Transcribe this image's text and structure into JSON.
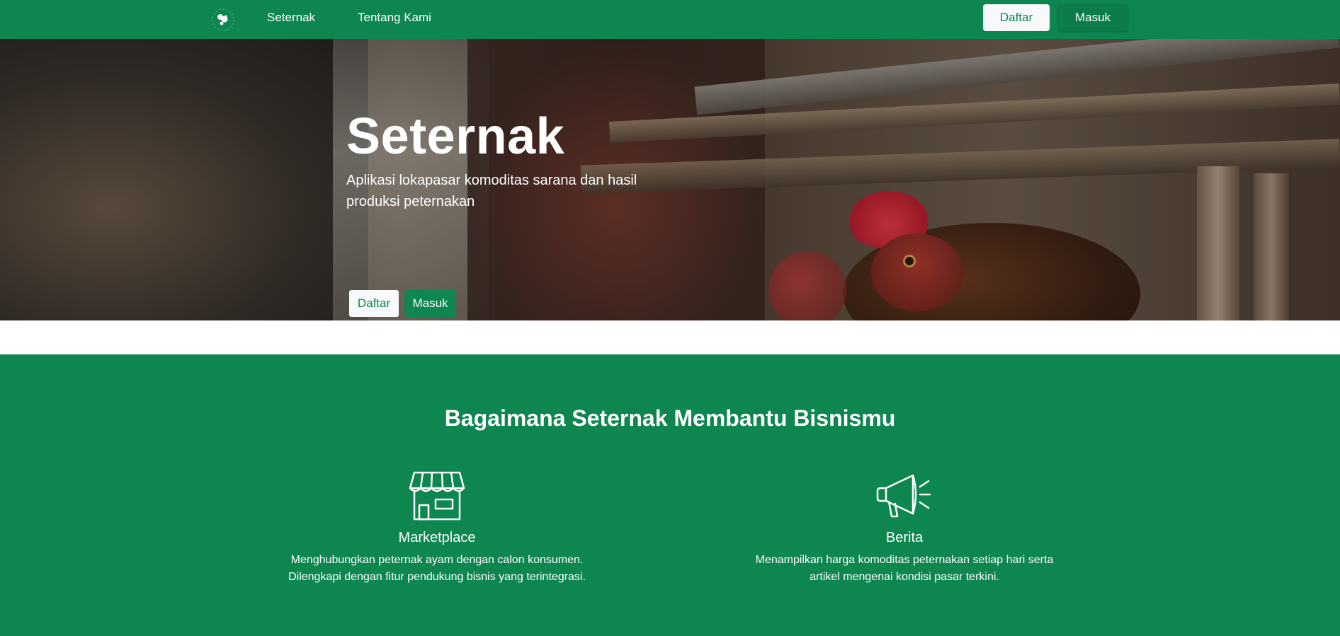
{
  "navbar": {
    "logo_icon": "chicken-logo-icon",
    "links": [
      "Seternak",
      "Tentang Kami"
    ],
    "daftar_label": "Daftar",
    "masuk_label": "Masuk"
  },
  "hero": {
    "title": "Seternak",
    "subtitle": "Aplikasi lokapasar komoditas sarana dan hasil produksi peternakan",
    "daftar_label": "Daftar",
    "masuk_label": "Masuk",
    "background": "chickens-in-coop-photo"
  },
  "features": {
    "title": "Bagaimana Seternak Membantu Bisnismu",
    "items": [
      {
        "icon": "storefront-icon",
        "title": "Marketplace",
        "description": "Menghubungkan peternak ayam dengan calon konsumen. Dilengkapi dengan fitur pendukung bisnis yang terintegrasi."
      },
      {
        "icon": "megaphone-icon",
        "title": "Berita",
        "description": "Menampilkan harga komoditas peternakan setiap hari serta artikel mengenai kondisi pasar terkini."
      }
    ]
  },
  "colors": {
    "brand_green": "#0e8650",
    "light_button": "#f8f9fa",
    "text_white": "#ffffff"
  }
}
